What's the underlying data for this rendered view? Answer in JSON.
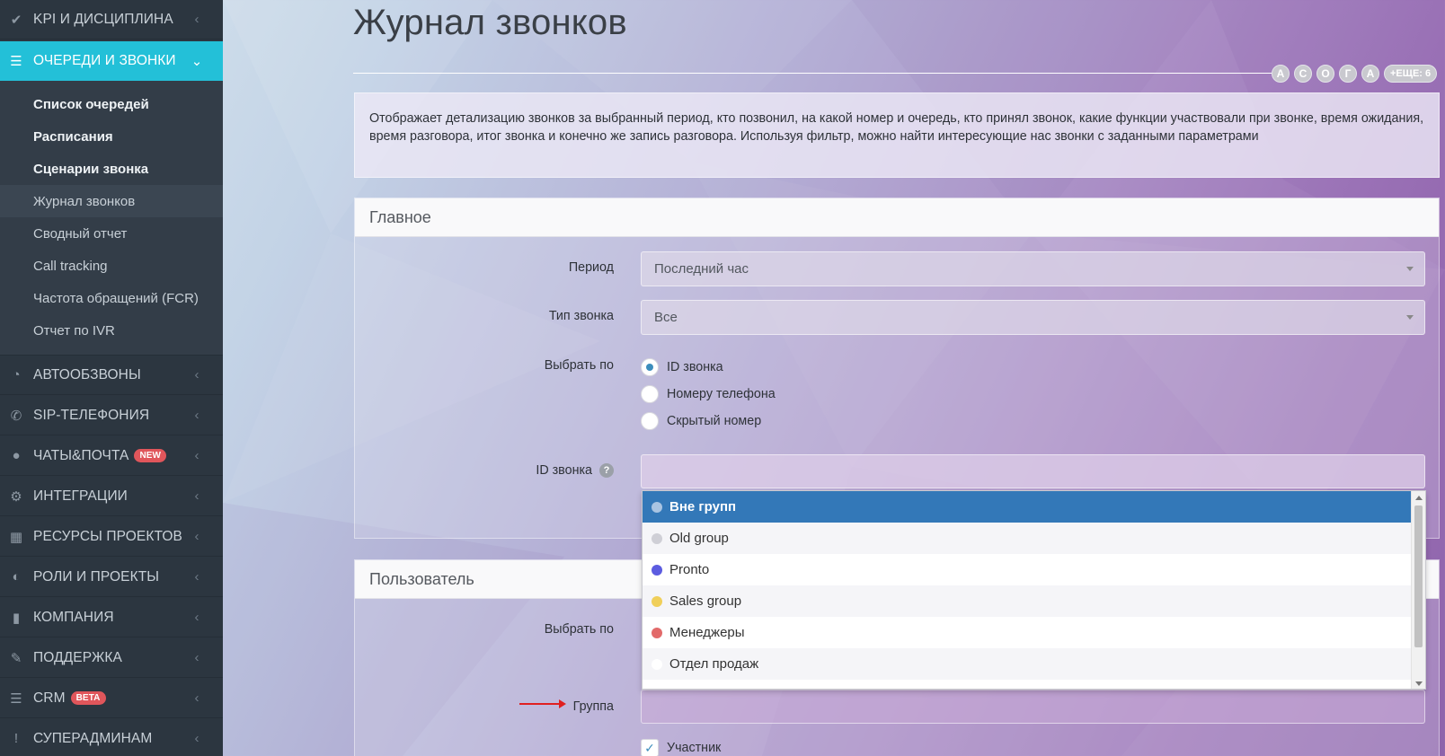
{
  "sidebar": {
    "items": [
      {
        "label": "KPI И ДИСЦИПЛИНА",
        "icon": "check-icon"
      },
      {
        "label": "ОЧЕРЕДИ И ЗВОНКИ",
        "icon": "list-icon"
      },
      {
        "label": "АВТООБЗВОНЫ",
        "icon": "clock-icon"
      },
      {
        "label": "SIP-ТЕЛЕФОНИЯ",
        "icon": "phone-icon"
      },
      {
        "label": "ЧАТЫ&ПОЧТА",
        "icon": "chat-icon",
        "badge": "NEW"
      },
      {
        "label": "ИНТЕГРАЦИИ",
        "icon": "cogs-icon"
      },
      {
        "label": "РЕСУРСЫ ПРОЕКТОВ",
        "icon": "grid-icon"
      },
      {
        "label": "РОЛИ И ПРОЕКТЫ",
        "icon": "toggle-icon"
      },
      {
        "label": "КОМПАНИЯ",
        "icon": "bar-chart-icon"
      },
      {
        "label": "ПОДДЕРЖКА",
        "icon": "wrench-icon"
      },
      {
        "label": "CRM",
        "icon": "list-icon",
        "badge": "BETA"
      },
      {
        "label": "СУПЕРАДМИНАМ",
        "icon": "exclamation-icon"
      }
    ],
    "submenu": [
      "Список очередей",
      "Расписания",
      "Сценарии звонка",
      "Журнал звонков",
      "Сводный отчет",
      "Call tracking",
      "Частота обращений (FCR)",
      "Отчет по IVR"
    ]
  },
  "page": {
    "title": "Журнал звонков",
    "avatars": [
      "А",
      "С",
      "О",
      "Г",
      "А"
    ],
    "avatars_more": "+ЕЩЕ: 6",
    "description": "Отображает детализацию звонков за выбранный период, кто позвонил, на какой номер и очередь, кто принял звонок, какие функции участвовали при звонке, время ожидания, время разговора, итог звонка и конечно же запись разговора. Используя фильтр, можно найти интересующие нас звонки с заданными параметрами"
  },
  "main_panel": {
    "title": "Главное",
    "period_label": "Период",
    "period_value": "Последний час",
    "call_type_label": "Тип звонка",
    "call_type_value": "Все",
    "select_by_label": "Выбрать по",
    "radio_options": [
      "ID звонка",
      "Номеру телефона",
      "Скрытый номер"
    ],
    "call_id_label": "ID звонка",
    "help": "?"
  },
  "user_panel": {
    "title": "Пользователь",
    "select_by_label": "Выбрать по",
    "group_label": "Группа",
    "participant_label": "Участник"
  },
  "dropdown": {
    "options": [
      {
        "label": "Вне групп",
        "color": "#a9c4e2"
      },
      {
        "label": "Old group",
        "color": "#cfcfd6"
      },
      {
        "label": "Pronto",
        "color": "#5c5ce0"
      },
      {
        "label": "Sales group",
        "color": "#f0cf5a"
      },
      {
        "label": "Менеджеры",
        "color": "#e26a6a"
      },
      {
        "label": "Отдел продаж",
        "color": "#ffffff"
      }
    ]
  },
  "colors": {
    "sidebar_bg": "#2c3640",
    "accent": "#23c0d8",
    "selected_option": "#3378b8",
    "arrow": "#e02020"
  }
}
